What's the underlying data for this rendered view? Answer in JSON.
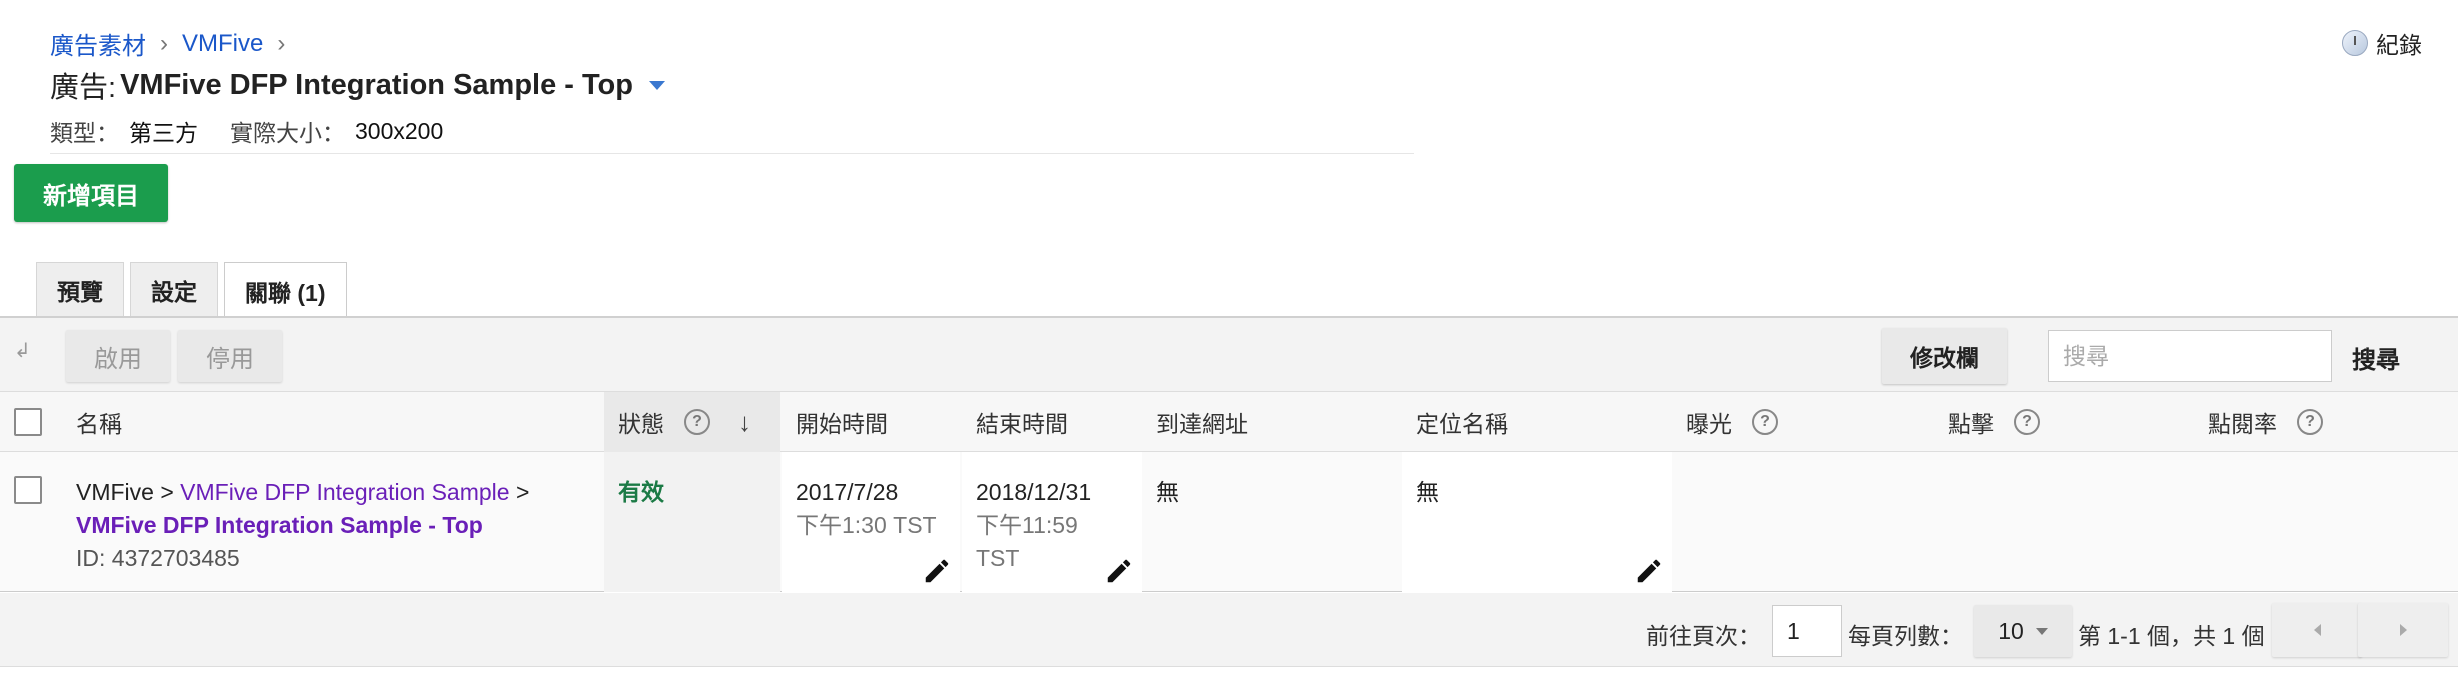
{
  "breadcrumb": {
    "items": [
      "廣告素材",
      "VMFive"
    ],
    "separator": "›"
  },
  "header": {
    "title_prefix": "廣告:",
    "title_name": "VMFive DFP Integration Sample - Top",
    "type_label": "類型：",
    "type_value": "第三方",
    "size_label": "實際大小：",
    "size_value": "300x200",
    "history_label": "紀錄"
  },
  "actions": {
    "add_button": "新增項目"
  },
  "tabs": [
    {
      "label": "預覽",
      "active": false
    },
    {
      "label": "設定",
      "active": false
    },
    {
      "label": "關聯 (1)",
      "active": true
    }
  ],
  "toolbar": {
    "enable": "啟用",
    "disable": "停用",
    "columns": "修改欄",
    "search_placeholder": "搜尋",
    "search_button": "搜尋"
  },
  "table": {
    "columns": [
      "名稱",
      "狀態",
      "開始時間",
      "結束時間",
      "到達網址",
      "定位名稱",
      "曝光",
      "點擊",
      "點閱率"
    ],
    "row": {
      "name_prefix": "VMFive >",
      "name_link1": "VMFive DFP Integration Sample",
      "name_sep": ">",
      "name_link2": "VMFive DFP Integration Sample - Top",
      "id": "ID: 4372703485",
      "status": "有效",
      "start_date": "2017/7/28",
      "start_time": "下午1:30 TST",
      "end_date": "2018/12/31",
      "end_time": "下午11:59",
      "end_tz": "TST",
      "url": "無",
      "target": "無"
    }
  },
  "pagination": {
    "goto_label": "前往頁次：",
    "page": "1",
    "per_page_label": "每頁列數：",
    "per_page": "10",
    "summary": "第 1-1 個，共 1 個"
  },
  "colors": {
    "accent_green": "#1b9d4d",
    "link_blue": "#1a57c9",
    "link_purple": "#6a1fb8",
    "status_green": "#1b7a45"
  }
}
